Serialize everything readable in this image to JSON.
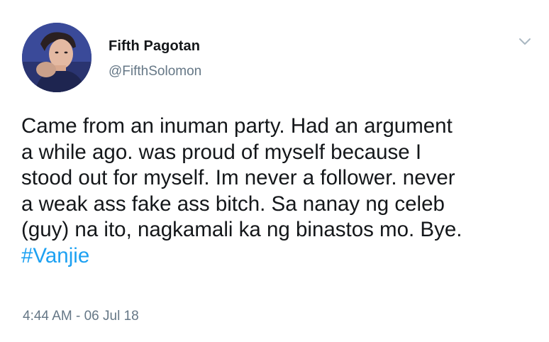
{
  "author": {
    "display_name": "Fifth Pagotan",
    "handle": "@FifthSolomon",
    "avatar_icon": "profile-photo"
  },
  "tweet": {
    "lines": [
      "Came from an inuman party. Had an argument",
      "a while ago. was proud of myself because I",
      "stood out for myself. Im never a follower. never",
      "a weak ass fake ass bitch. Sa nanay  ng celeb",
      "(guy) na ito, nagkamali ka ng binastos mo. Bye."
    ],
    "hashtag": "#Vanjie",
    "timestamp": "4:44 AM - 06 Jul 18"
  },
  "menu": {
    "icon": "chevron-down-icon"
  },
  "colors": {
    "text": "#14171a",
    "secondary": "#657786",
    "link": "#1da1f2"
  }
}
